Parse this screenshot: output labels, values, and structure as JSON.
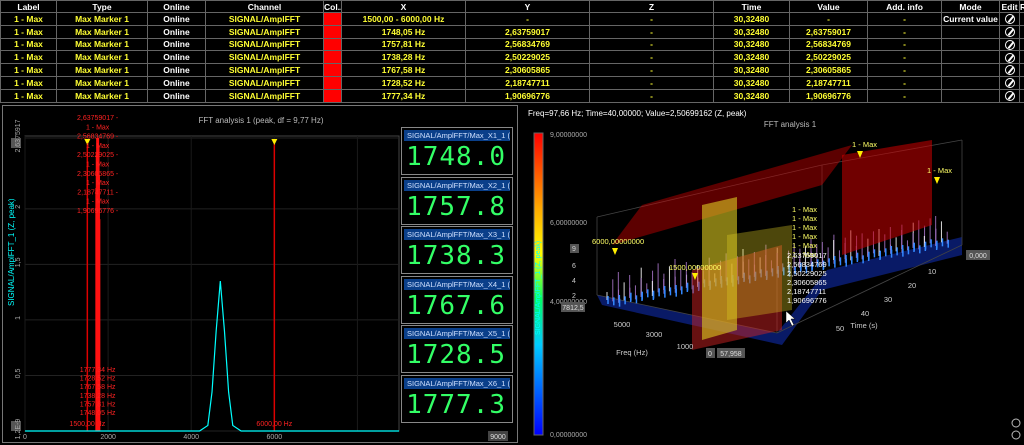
{
  "table": {
    "headers": [
      "Label",
      "Type",
      "Online",
      "Channel",
      "Col...",
      "X",
      "Y",
      "Z",
      "Time",
      "Value",
      "Add. info",
      "Mode",
      "Edit",
      "Rem..."
    ],
    "rows": [
      {
        "label": "1 - Max",
        "type": "Max Marker 1",
        "online": "Online",
        "channel": "SIGNAL/AmplFFT",
        "x": "1500,00 - 6000,00 Hz",
        "y": "-",
        "z": "-",
        "time": "30,32480",
        "value": "-",
        "info": "-",
        "mode": "Current value"
      },
      {
        "label": "1 - Max",
        "type": "Max Marker 1",
        "online": "Online",
        "channel": "SIGNAL/AmplFFT",
        "x": "1748,05 Hz",
        "y": "2,63759017",
        "z": "-",
        "time": "30,32480",
        "value": "2,63759017",
        "info": "-",
        "mode": ""
      },
      {
        "label": "1 - Max",
        "type": "Max Marker 1",
        "online": "Online",
        "channel": "SIGNAL/AmplFFT",
        "x": "1757,81 Hz",
        "y": "2,56834769",
        "z": "-",
        "time": "30,32480",
        "value": "2,56834769",
        "info": "-",
        "mode": ""
      },
      {
        "label": "1 - Max",
        "type": "Max Marker 1",
        "online": "Online",
        "channel": "SIGNAL/AmplFFT",
        "x": "1738,28 Hz",
        "y": "2,50229025",
        "z": "-",
        "time": "30,32480",
        "value": "2,50229025",
        "info": "-",
        "mode": ""
      },
      {
        "label": "1 - Max",
        "type": "Max Marker 1",
        "online": "Online",
        "channel": "SIGNAL/AmplFFT",
        "x": "1767,58 Hz",
        "y": "2,30605865",
        "z": "-",
        "time": "30,32480",
        "value": "2,30605865",
        "info": "-",
        "mode": ""
      },
      {
        "label": "1 - Max",
        "type": "Max Marker 1",
        "online": "Online",
        "channel": "SIGNAL/AmplFFT",
        "x": "1728,52 Hz",
        "y": "2,18747711",
        "z": "-",
        "time": "30,32480",
        "value": "2,18747711",
        "info": "-",
        "mode": ""
      },
      {
        "label": "1 - Max",
        "type": "Max Marker 1",
        "online": "Online",
        "channel": "SIGNAL/AmplFFT",
        "x": "1777,34 Hz",
        "y": "1,90696776",
        "z": "-",
        "time": "30,32480",
        "value": "1,90696776",
        "info": "-",
        "mode": ""
      }
    ],
    "color_swatch": "#ff0000"
  },
  "fft": {
    "title": "FFT analysis 1 (peak, df = 9,77 Hz)",
    "ylabel": "SIGNAL/AmplFFT_1 (Z, peak)",
    "y_ticks": [
      "2,6375917",
      "2",
      "1,5",
      "1",
      "0,5",
      "1,2E-9"
    ],
    "x_ticks": [
      "0",
      "2000",
      "4000",
      "6000",
      "8000"
    ],
    "x_marker_labels": [
      "1500,00 Hz",
      "6000,00 Hz"
    ],
    "marker_top_labels": [
      "2,63759017 -",
      "1 - Max",
      "2,56834769 -",
      "1 - Max",
      "2,50229025 -",
      "1 - Max",
      "2,30605865 -",
      "1 - Max",
      "2,18747711 -",
      "1 - Max",
      "1,90696776 -"
    ],
    "marker_bottom_labels": [
      "1777,34 Hz",
      "1728,52 Hz",
      "1767,58 Hz",
      "1738,28 Hz",
      "1757,81 Hz",
      "1748,05 Hz"
    ],
    "readouts": [
      {
        "label": "SIGNAL/AmplFFT/Max_X1_1 (Hz)",
        "value": "1748.0"
      },
      {
        "label": "SIGNAL/AmplFFT/Max_X2_1 (Hz)",
        "value": "1757.8"
      },
      {
        "label": "SIGNAL/AmplFFT/Max_X3_1 (Hz)",
        "value": "1738.3"
      },
      {
        "label": "SIGNAL/AmplFFT/Max_X4_1 (Hz)",
        "value": "1767.6"
      },
      {
        "label": "SIGNAL/AmplFFT/Max_X5_1 (Hz)",
        "value": "1728.5"
      },
      {
        "label": "SIGNAL/AmplFFT/Max_X6_1 (Hz)",
        "value": "1777.3"
      }
    ],
    "chart_data": {
      "type": "line",
      "x_range": [
        0,
        9000
      ],
      "y_range": [
        0,
        2.6375917
      ],
      "series": [
        {
          "color": "#00ffff",
          "x": [
            0,
            4200,
            4400,
            4500,
            4600,
            4700,
            4800,
            4900,
            5000,
            5200,
            9000
          ],
          "y": [
            0,
            0,
            0.05,
            0.35,
            0.9,
            1.35,
            0.9,
            0.35,
            0.05,
            0,
            0
          ]
        }
      ],
      "bars": [
        {
          "x": 1748.05,
          "y": 2.63759017
        },
        {
          "x": 1757.81,
          "y": 2.56834769
        },
        {
          "x": 1738.28,
          "y": 2.50229025
        },
        {
          "x": 1767.58,
          "y": 2.30605865
        },
        {
          "x": 1728.52,
          "y": 2.18747711
        },
        {
          "x": 1777.34,
          "y": 1.90696776
        }
      ],
      "band": [
        1500,
        6000
      ]
    }
  },
  "plot3d": {
    "status": "Freq=97,66 Hz; Time=40,00000; Value=2,50699162  (Z, peak)",
    "title": "FFT analysis 1",
    "colorbar_ticks": [
      "9,00000000",
      "6,00000000",
      "4,00000000",
      "0,00000000"
    ],
    "colorbar_axis": "SIGNAL/AmplFFT_1 (Z, peak)",
    "z_ticks": [
      "9",
      "6",
      "4",
      "2"
    ],
    "freq_label": "Freq (Hz)",
    "freq_ticks": [
      "5000",
      "3000",
      "1000"
    ],
    "time_label": "Time (s)",
    "time_ticks": [
      "10",
      "20",
      "30",
      "40",
      "50"
    ],
    "range_labels": [
      "6000,00000000",
      "1500,00000000"
    ],
    "max_labels": [
      "1 - Max",
      "1 - Max"
    ],
    "stack_labels": [
      "1 - Max",
      "1 - Max",
      "1 - Max",
      "1 - Max",
      "1 - Max",
      "1 - Max"
    ],
    "stack_values": [
      "2,63759017",
      "2,56834769",
      "2,50229025",
      "2,30605865",
      "2,18747711",
      "1,90696776"
    ],
    "corner_labels": [
      "7812,5",
      "57,958",
      "0",
      "0,000"
    ]
  }
}
